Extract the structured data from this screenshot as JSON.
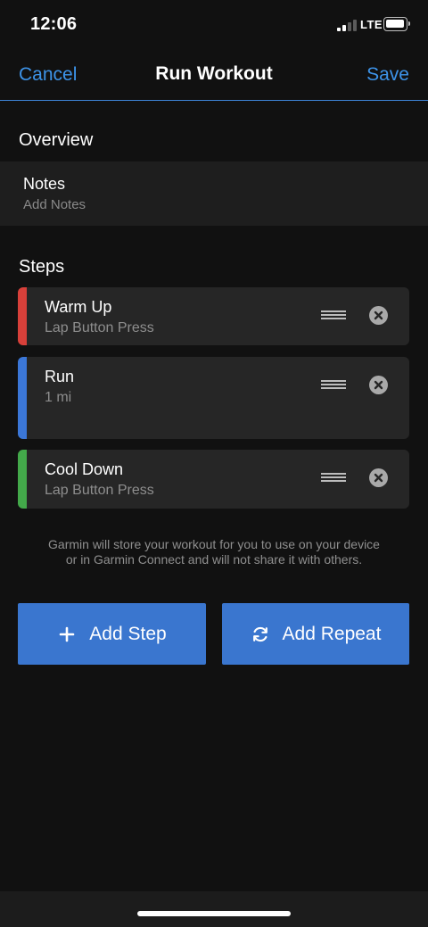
{
  "status_bar": {
    "time": "12:06",
    "network": "LTE"
  },
  "nav": {
    "cancel_label": "Cancel",
    "title": "Run Workout",
    "save_label": "Save"
  },
  "overview": {
    "header": "Overview",
    "notes_label": "Notes",
    "notes_placeholder": "Add Notes"
  },
  "steps": {
    "header": "Steps",
    "items": [
      {
        "title": "Warm Up",
        "subtitle": "Lap Button Press",
        "color": "#d8403a"
      },
      {
        "title": "Run",
        "subtitle": "1 mi",
        "color": "#3b77d8"
      },
      {
        "title": "Cool Down",
        "subtitle": "Lap Button Press",
        "color": "#43a94a"
      }
    ]
  },
  "disclaimer": {
    "line1": "Garmin will store your workout for you to use on your device",
    "line2": "or in Garmin Connect and will not share it with others."
  },
  "actions": {
    "add_step_label": "Add Step",
    "add_repeat_label": "Add Repeat"
  },
  "icons": {
    "drag": "drag-handle-icon",
    "remove": "close-circle-icon",
    "add": "plus-icon",
    "repeat": "refresh-icon"
  }
}
